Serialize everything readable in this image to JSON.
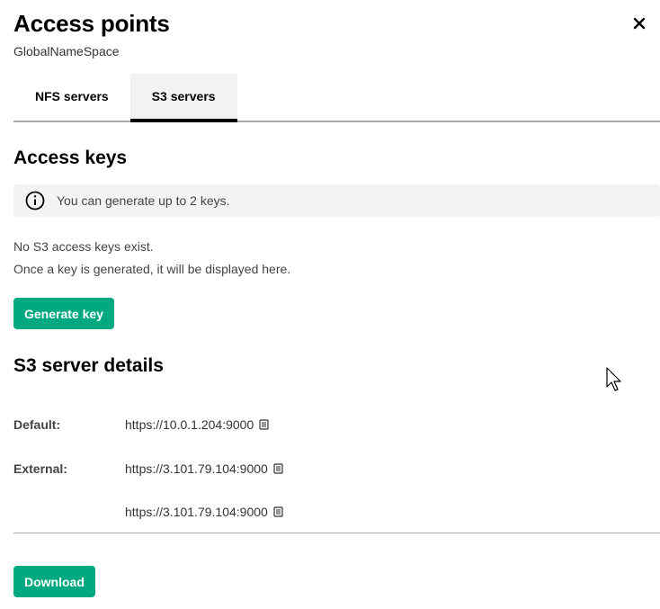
{
  "header": {
    "title": "Access points",
    "subtitle": "GlobalNameSpace"
  },
  "tabs": [
    {
      "label": "NFS servers",
      "active": false
    },
    {
      "label": "S3 servers",
      "active": true
    }
  ],
  "access_keys": {
    "title": "Access keys",
    "info": "You can generate up to 2 keys.",
    "empty_line_1": "No S3 access keys exist.",
    "empty_line_2": "Once a key is generated, it will be displayed here.",
    "generate_label": "Generate key"
  },
  "server_details": {
    "title": "S3 server details",
    "default_label": "Default:",
    "default_url": "https://10.0.1.204:9000",
    "external_label": "External:",
    "external_urls": [
      "https://3.101.79.104:9000",
      "https://3.101.79.104:9000"
    ]
  },
  "download_label": "Download",
  "colors": {
    "accent": "#01a982",
    "tab_underline": "#000000"
  }
}
